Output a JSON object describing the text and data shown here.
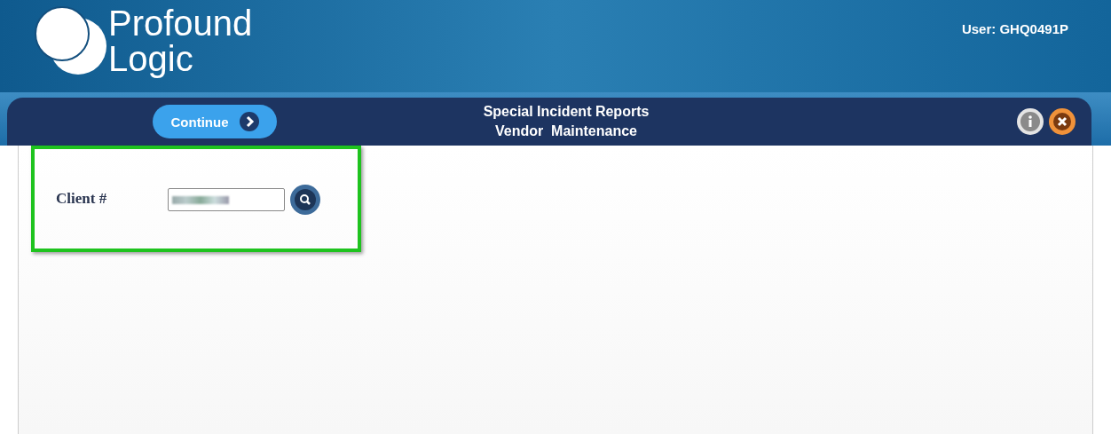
{
  "header": {
    "logo_line_1": "Profound",
    "logo_line_2": "Logic",
    "user": "User: GHQ0491P"
  },
  "toolbar": {
    "continue_button": "Continue",
    "title_line_1": "Special Incident Reports",
    "title_line_2": "Vendor  Maintenance"
  },
  "form": {
    "highlighted": true,
    "client_label": "Client #"
  }
}
